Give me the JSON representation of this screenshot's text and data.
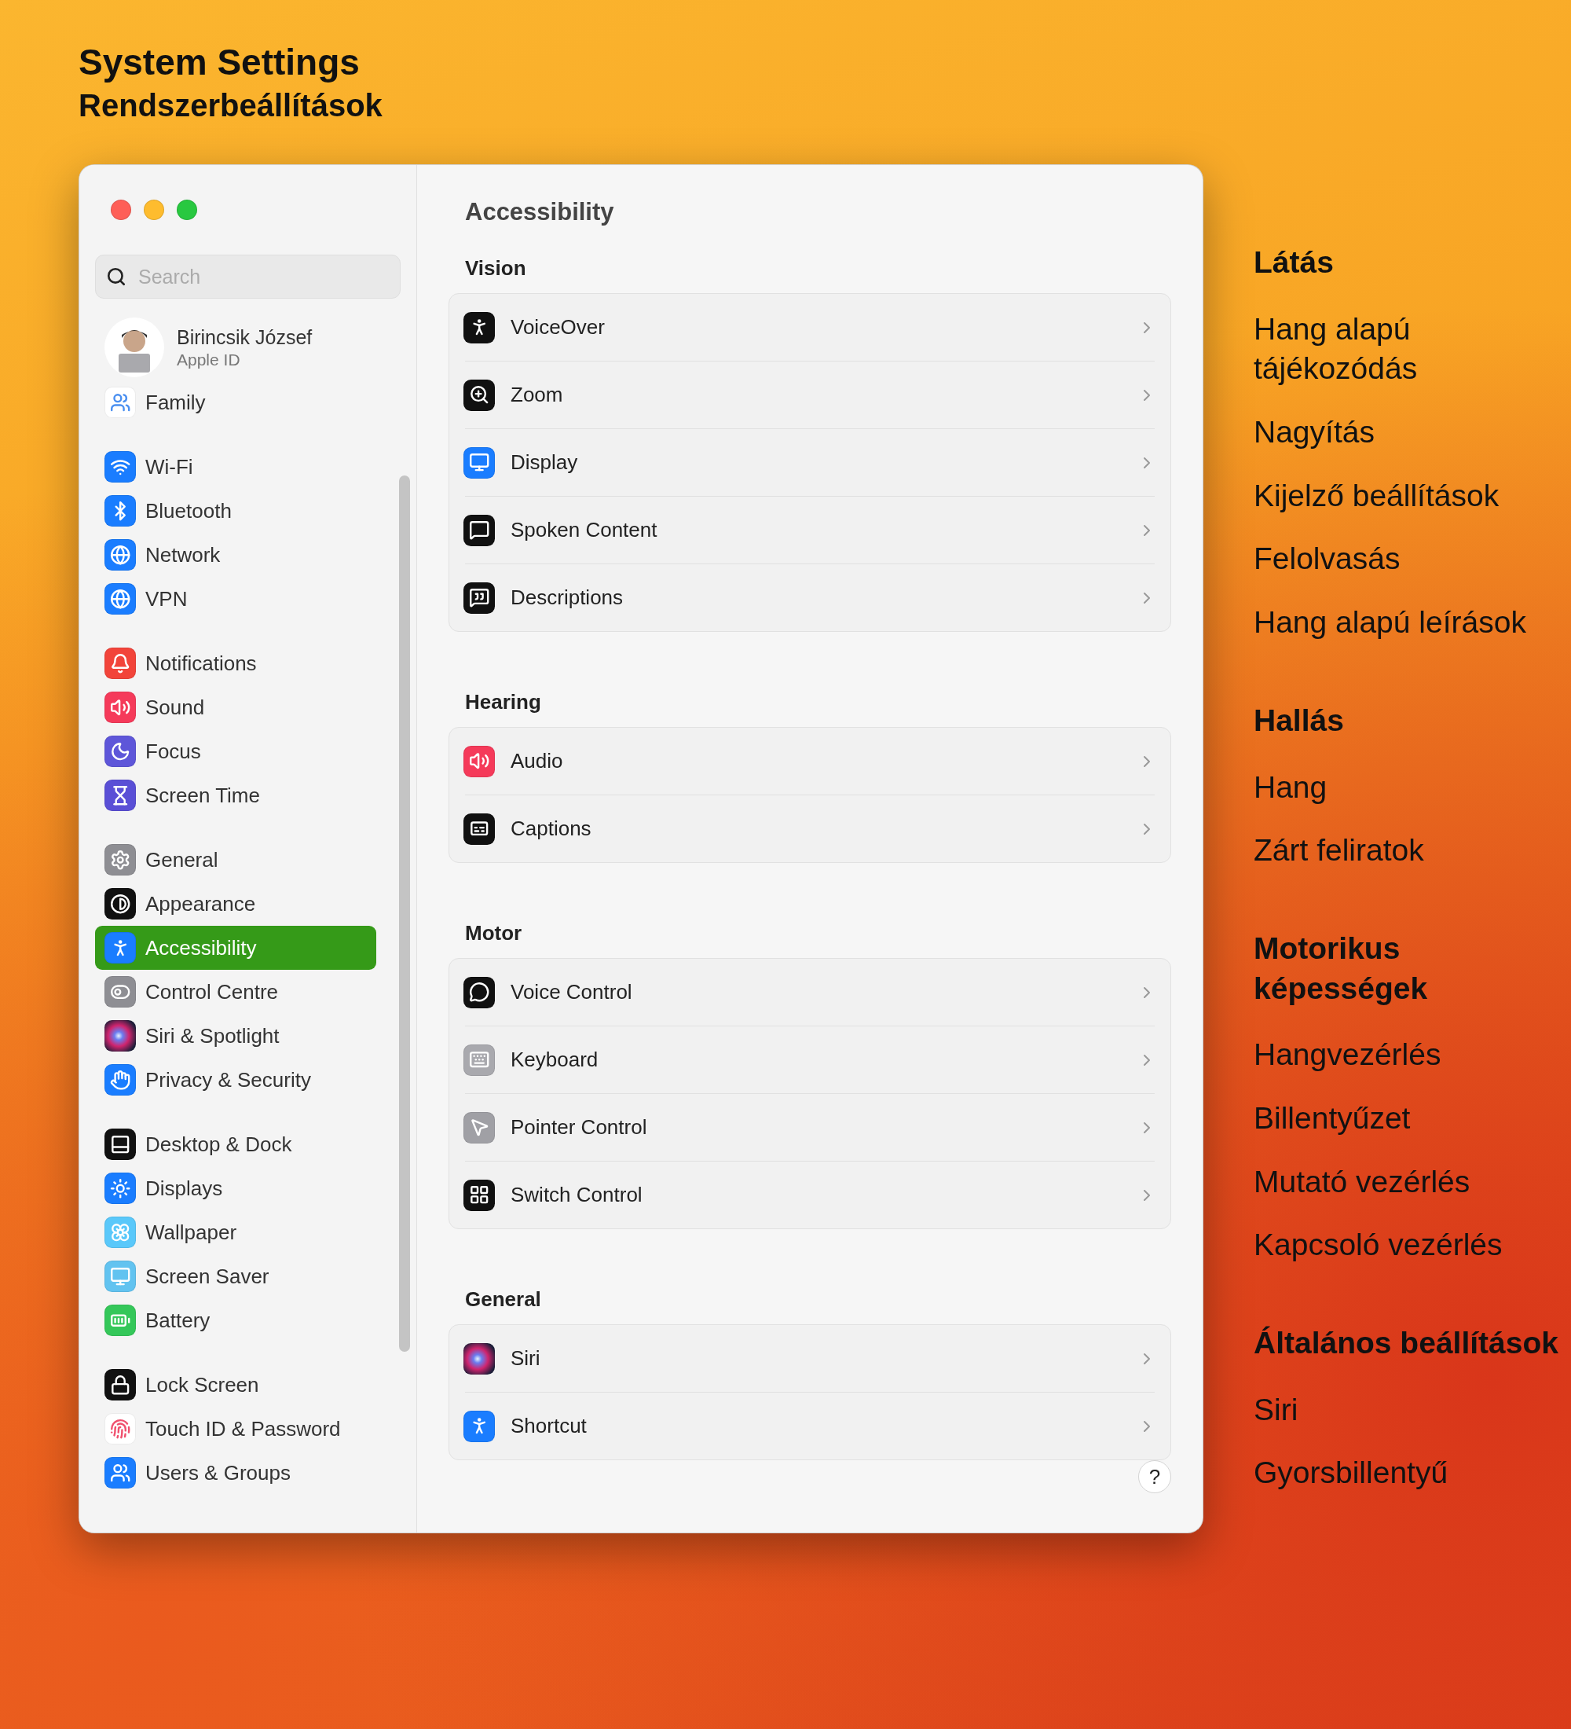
{
  "heading": {
    "title": "System Settings",
    "subtitle": "Rendszerbeállítások"
  },
  "window": {
    "search": {
      "placeholder": "Search"
    },
    "account": {
      "name": "Birincsik József",
      "subtitle": "Apple ID"
    },
    "sidebar": {
      "groups": [
        {
          "items": [
            {
              "label": "Family",
              "selected": false
            }
          ]
        },
        {
          "items": [
            {
              "label": "Wi-Fi",
              "selected": false
            },
            {
              "label": "Bluetooth",
              "selected": false
            },
            {
              "label": "Network",
              "selected": false
            },
            {
              "label": "VPN",
              "selected": false
            }
          ]
        },
        {
          "items": [
            {
              "label": "Notifications",
              "selected": false
            },
            {
              "label": "Sound",
              "selected": false
            },
            {
              "label": "Focus",
              "selected": false
            },
            {
              "label": "Screen Time",
              "selected": false
            }
          ]
        },
        {
          "items": [
            {
              "label": "General",
              "selected": false
            },
            {
              "label": "Appearance",
              "selected": false
            },
            {
              "label": "Accessibility",
              "selected": true
            },
            {
              "label": "Control Centre",
              "selected": false
            },
            {
              "label": "Siri & Spotlight",
              "selected": false
            },
            {
              "label": "Privacy & Security",
              "selected": false
            }
          ]
        },
        {
          "items": [
            {
              "label": "Desktop & Dock",
              "selected": false
            },
            {
              "label": "Displays",
              "selected": false
            },
            {
              "label": "Wallpaper",
              "selected": false
            },
            {
              "label": "Screen Saver",
              "selected": false
            },
            {
              "label": "Battery",
              "selected": false
            }
          ]
        },
        {
          "items": [
            {
              "label": "Lock Screen",
              "selected": false
            },
            {
              "label": "Touch ID & Password",
              "selected": false
            },
            {
              "label": "Users & Groups",
              "selected": false
            }
          ]
        }
      ]
    },
    "content": {
      "title": "Accessibility",
      "sections": [
        {
          "title": "Vision",
          "rows": [
            {
              "label": "VoiceOver"
            },
            {
              "label": "Zoom"
            },
            {
              "label": "Display"
            },
            {
              "label": "Spoken Content"
            },
            {
              "label": "Descriptions"
            }
          ]
        },
        {
          "title": "Hearing",
          "rows": [
            {
              "label": "Audio"
            },
            {
              "label": "Captions"
            }
          ]
        },
        {
          "title": "Motor",
          "rows": [
            {
              "label": "Voice Control"
            },
            {
              "label": "Keyboard"
            },
            {
              "label": "Pointer Control"
            },
            {
              "label": "Switch Control"
            }
          ]
        },
        {
          "title": "General",
          "rows": [
            {
              "label": "Siri"
            },
            {
              "label": "Shortcut"
            }
          ]
        }
      ],
      "help_button": "?"
    }
  },
  "annotations": {
    "sections": [
      {
        "title": "Látás",
        "items": [
          "Hang alapú tájékozódás",
          "Nagyítás",
          "Kijelző beállítások",
          "Felolvasás",
          "Hang alapú leírások"
        ]
      },
      {
        "title": "Hallás",
        "items": [
          "Hang",
          "Zárt feliratok"
        ]
      },
      {
        "title": "Motorikus képességek",
        "items": [
          "Hangvezérlés",
          "Billentyűzet",
          "Mutató vezérlés",
          "Kapcsoló vezérlés"
        ]
      },
      {
        "title": "Általános beállítások",
        "items": [
          "Siri",
          "Gyorsbillentyű"
        ]
      }
    ]
  }
}
